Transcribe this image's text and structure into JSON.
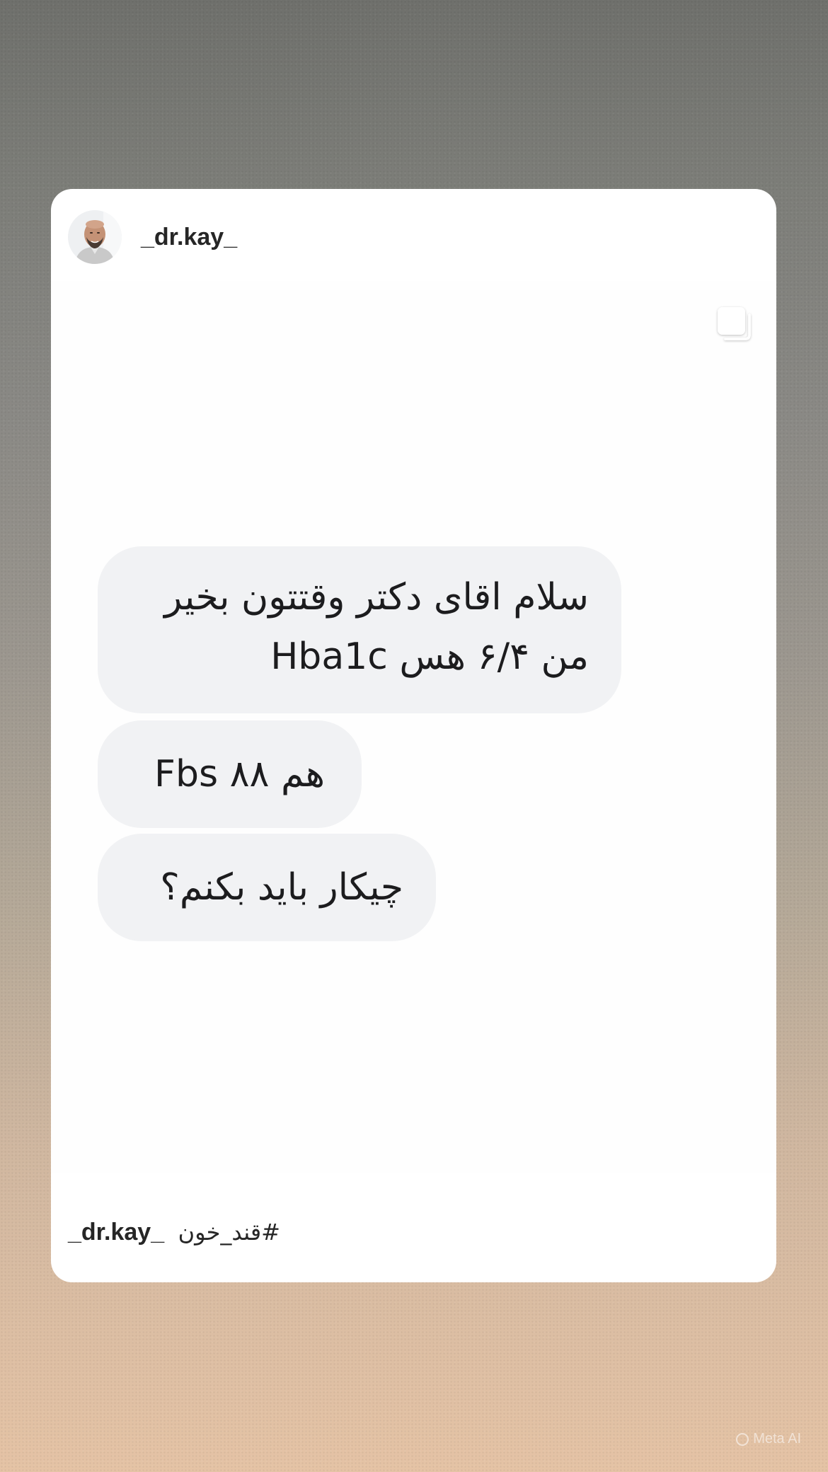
{
  "post": {
    "username": "_dr.kay_",
    "media_type_icon": "multi-image-icon",
    "messages": [
      {
        "lines": [
          "سلام اقای دکتر وقتتون بخیر",
          "من ۶/۴ هس Hba1c"
        ]
      },
      {
        "text": "هم ۸۸ Fbs"
      },
      {
        "text": "چیکار باید بکنم؟"
      }
    ],
    "caption": {
      "username": "_dr.kay_",
      "hashtag": "#قند_خون"
    }
  },
  "watermark": "Meta AI",
  "colors": {
    "card": "#ffffff",
    "bubble": "#f1f2f4",
    "text": "#1c1c1e",
    "username": "#262626"
  }
}
